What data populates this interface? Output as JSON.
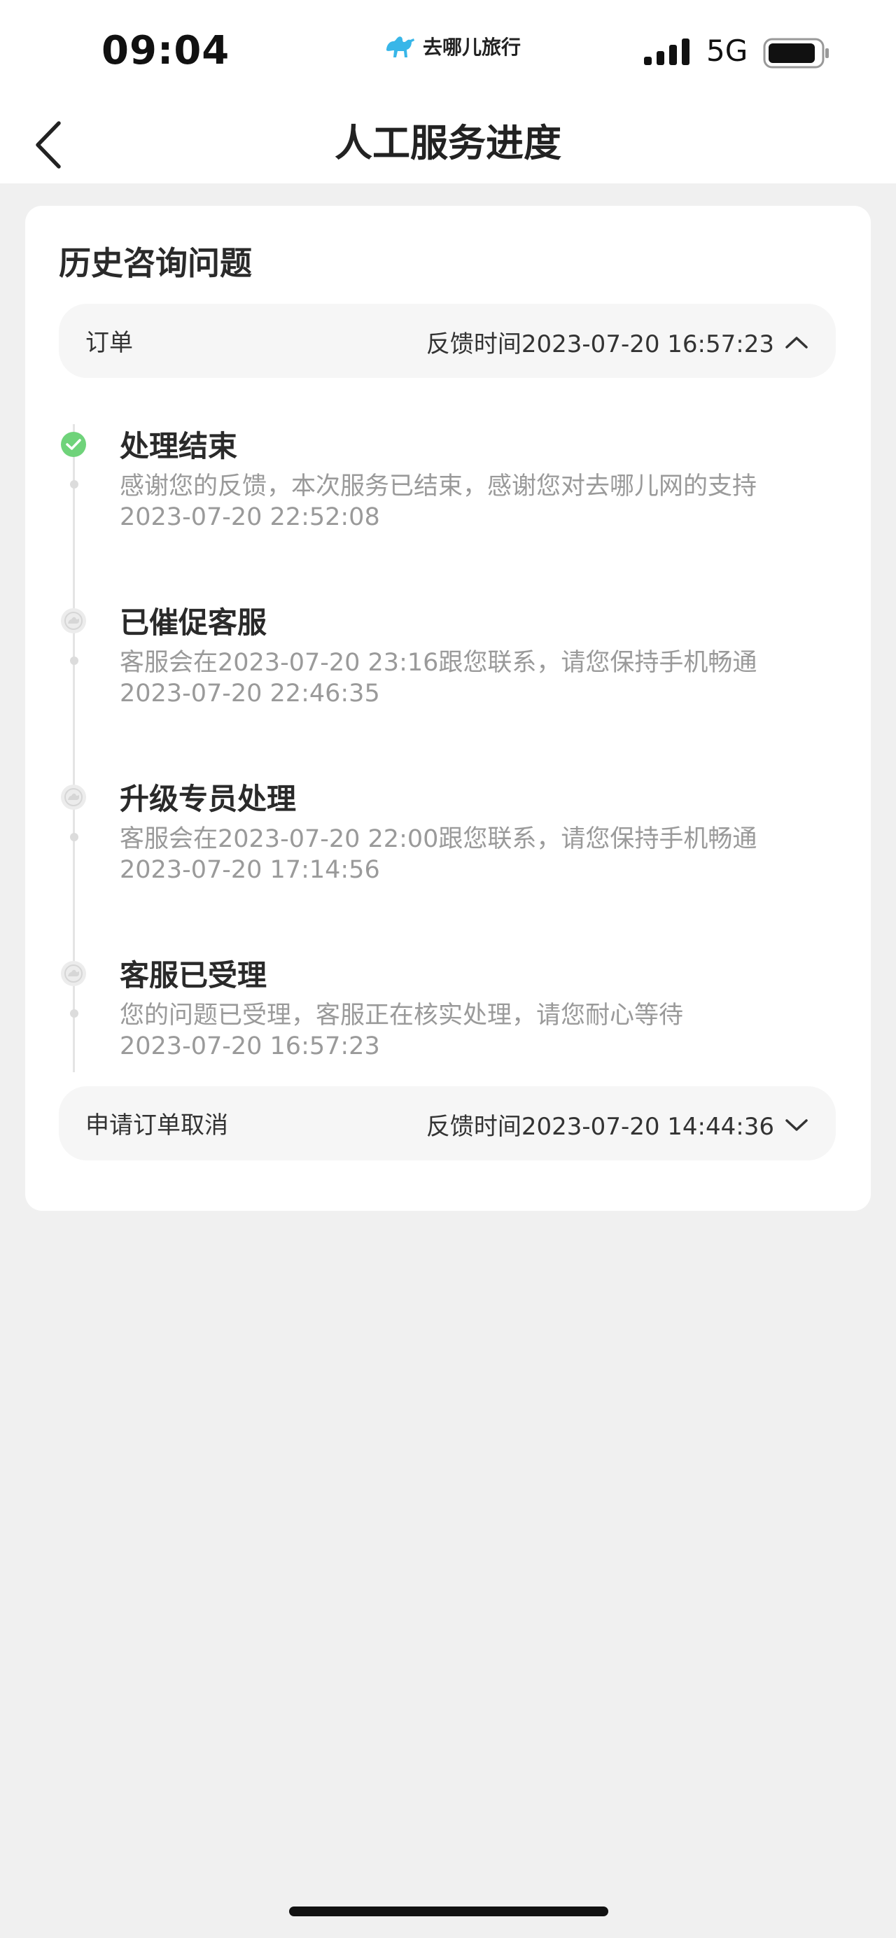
{
  "status_bar": {
    "time": "09:04",
    "brand": "去哪儿旅行",
    "network": "5G",
    "icons": [
      "camel-logo-icon",
      "signal-icon",
      "battery-icon"
    ]
  },
  "nav": {
    "title": "人工服务进度",
    "back_icon": "back-chevron-icon"
  },
  "card": {
    "title": "历史咨询问题",
    "sections": [
      {
        "label": "订单",
        "feedback_time": "反馈时间2023-07-20 16:57:23",
        "expanded": true,
        "icon": "chevron-up-icon"
      },
      {
        "label": "申请订单取消",
        "feedback_time": "反馈时间2023-07-20 14:44:36",
        "expanded": false,
        "icon": "chevron-down-icon"
      }
    ],
    "steps": [
      {
        "title": "处理结束",
        "desc": "感谢您的反馈，本次服务已结束，感谢您对去哪儿网的支持",
        "time": "2023-07-20 22:52:08",
        "state": "done",
        "icon": "check-circle-icon"
      },
      {
        "title": "已催促客服",
        "desc": "客服会在2023-07-20 23:16跟您联系，请您保持手机畅通",
        "time": "2023-07-20 22:46:35",
        "state": "past",
        "icon": "camel-badge-icon"
      },
      {
        "title": "升级专员处理",
        "desc": "客服会在2023-07-20 22:00跟您联系，请您保持手机畅通",
        "time": "2023-07-20 17:14:56",
        "state": "past",
        "icon": "camel-badge-icon"
      },
      {
        "title": "客服已受理",
        "desc": "您的问题已受理，客服正在核实处理，请您耐心等待",
        "time": "2023-07-20 16:57:23",
        "state": "past",
        "icon": "camel-badge-icon"
      }
    ]
  },
  "colors": {
    "accent_green": "#6fd37a",
    "muted_text": "#9a9a9a",
    "page_bg": "#f0f0f0",
    "bar_bg": "#f6f6f6",
    "brand_blue": "#38b6e8"
  }
}
